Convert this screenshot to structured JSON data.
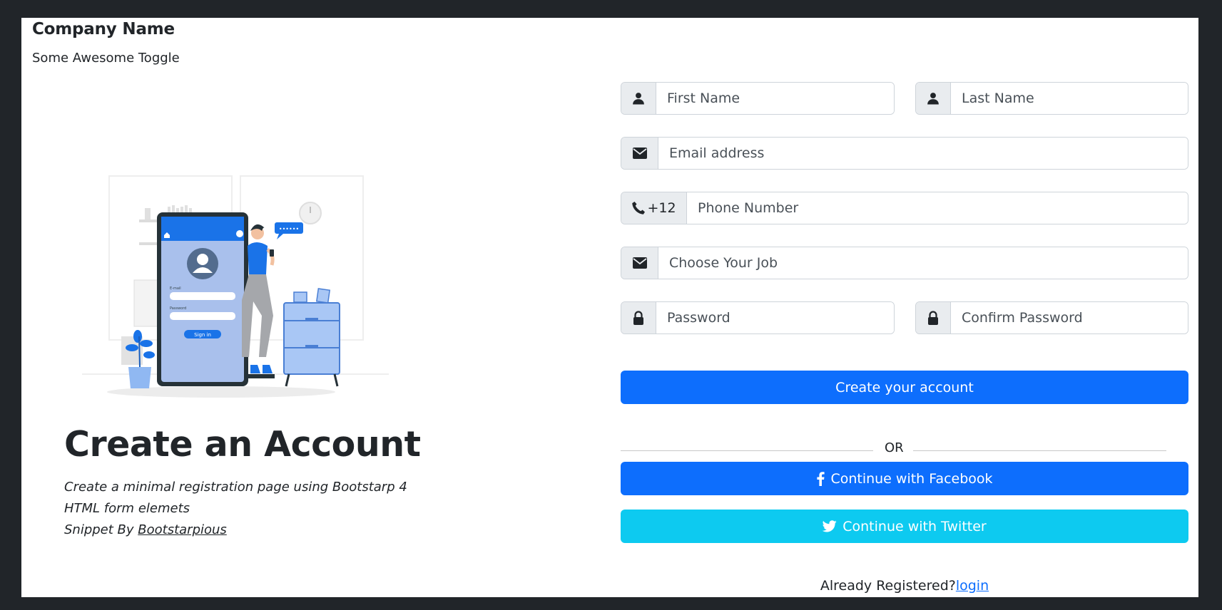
{
  "brand": "Company Name",
  "toggle": "Some Awesome Toggle",
  "hero": {
    "title": "Create an Account",
    "line1": "Create a minimal registration page using Bootstarp 4",
    "line2": "HTML form elemets",
    "line3_prefix": "Snippet By ",
    "line3_link": "Bootstarpious",
    "illustration": {
      "email_label": "E-mail",
      "password_label": "Password",
      "signin_label": "Sign in",
      "bubble_text": "••••••"
    }
  },
  "form": {
    "first_name": {
      "placeholder": "First Name",
      "icon": "user-icon"
    },
    "last_name": {
      "placeholder": "Last Name",
      "icon": "user-icon"
    },
    "email": {
      "placeholder": "Email address",
      "icon": "envelope-icon"
    },
    "phone": {
      "placeholder": "Phone Number",
      "icon": "phone-icon",
      "code": "+12"
    },
    "job": {
      "placeholder": "Choose Your Job",
      "icon": "envelope-icon"
    },
    "password": {
      "placeholder": "Password",
      "icon": "lock-icon"
    },
    "confirm_password": {
      "placeholder": "Confirm Password",
      "icon": "lock-icon"
    },
    "submit_label": "Create your account",
    "or_label": "OR",
    "facebook_label": "Continue with Facebook",
    "twitter_label": "Continue with Twitter",
    "already_text": "Already Registered?",
    "login_label": "login"
  },
  "colors": {
    "primary": "#0d6efd",
    "info": "#0dcaf0",
    "frame": "#212529"
  }
}
